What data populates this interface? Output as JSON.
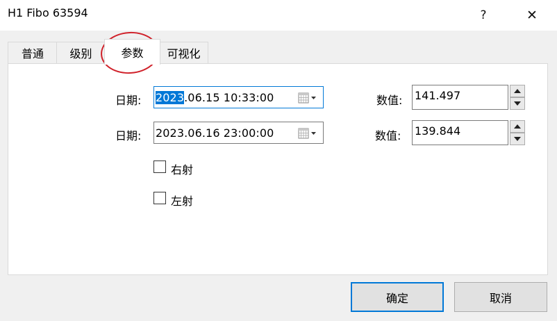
{
  "window": {
    "title": "H1 Fibo 63594",
    "help_glyph": "?",
    "close_glyph": "✕"
  },
  "tabs": [
    {
      "label": "普通",
      "active": false
    },
    {
      "label": "级别",
      "active": false
    },
    {
      "label": "参数",
      "active": true
    },
    {
      "label": "可视化",
      "active": false
    }
  ],
  "params": {
    "date1": {
      "label": "日期:",
      "value_selected": "2023",
      "value_rest": ".06.15 10:33:00"
    },
    "date2": {
      "label": "日期:",
      "value": "2023.06.16 23:00:00"
    },
    "value1": {
      "label": "数值:",
      "value": "141.497"
    },
    "value2": {
      "label": "数值:",
      "value": "139.844"
    },
    "ray_right": {
      "label": "右射",
      "checked": false
    },
    "ray_left": {
      "label": "左射",
      "checked": false
    }
  },
  "buttons": {
    "ok": "确定",
    "cancel": "取消"
  },
  "colors": {
    "accent": "#0078d7",
    "annotation": "#d0212a"
  },
  "icons": {
    "calendar": "calendar-dropdown-icon",
    "spin_up": "triangle-up-icon",
    "spin_down": "triangle-down-icon"
  }
}
